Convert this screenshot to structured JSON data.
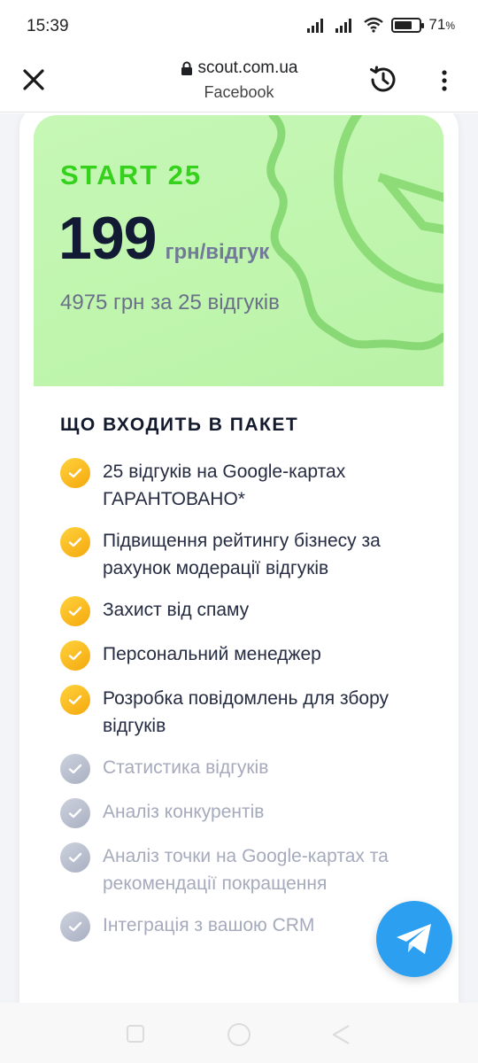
{
  "status_bar": {
    "time": "15:39",
    "battery_percent": "71",
    "battery_unit": "%",
    "battery_level": 0.71
  },
  "browser": {
    "url": "scout.com.ua",
    "subtitle": "Facebook",
    "close_icon": "close-icon",
    "history_icon": "history-icon",
    "menu_icon": "more-vertical-icon"
  },
  "plan": {
    "name": "START 25",
    "price": "199",
    "price_unit": "грн/відгук",
    "total": "4975 грн за 25 відгуків",
    "name_color": "#35d11c",
    "background_color": "#c3f5b2"
  },
  "features": {
    "title": "ЩО ВХОДИТЬ В ПАКЕТ",
    "items": [
      {
        "label": "25 відгуків на Google-картах ГАРАНТОВАНО*",
        "included": true
      },
      {
        "label": "Підвищення рейтингу бізнесу за рахунок модерації відгуків",
        "included": true
      },
      {
        "label": "Захист від спаму",
        "included": true
      },
      {
        "label": "Персональний менеджер",
        "included": true
      },
      {
        "label": "Розробка повідомлень для збору відгуків",
        "included": true
      },
      {
        "label": "Статистика відгуків",
        "included": false
      },
      {
        "label": "Аналіз конкурентів",
        "included": false
      },
      {
        "label": "Аналіз точки на Google-картах та рекомендації покращення",
        "included": false
      },
      {
        "label": "Інтеграція з вашою CRM",
        "included": false
      }
    ]
  },
  "telegram_button": {
    "icon": "telegram-icon",
    "color": "#2d9ff0"
  },
  "nav": {
    "recent_icon": "recent-apps-icon",
    "home_icon": "home-icon",
    "back_icon": "back-icon"
  }
}
